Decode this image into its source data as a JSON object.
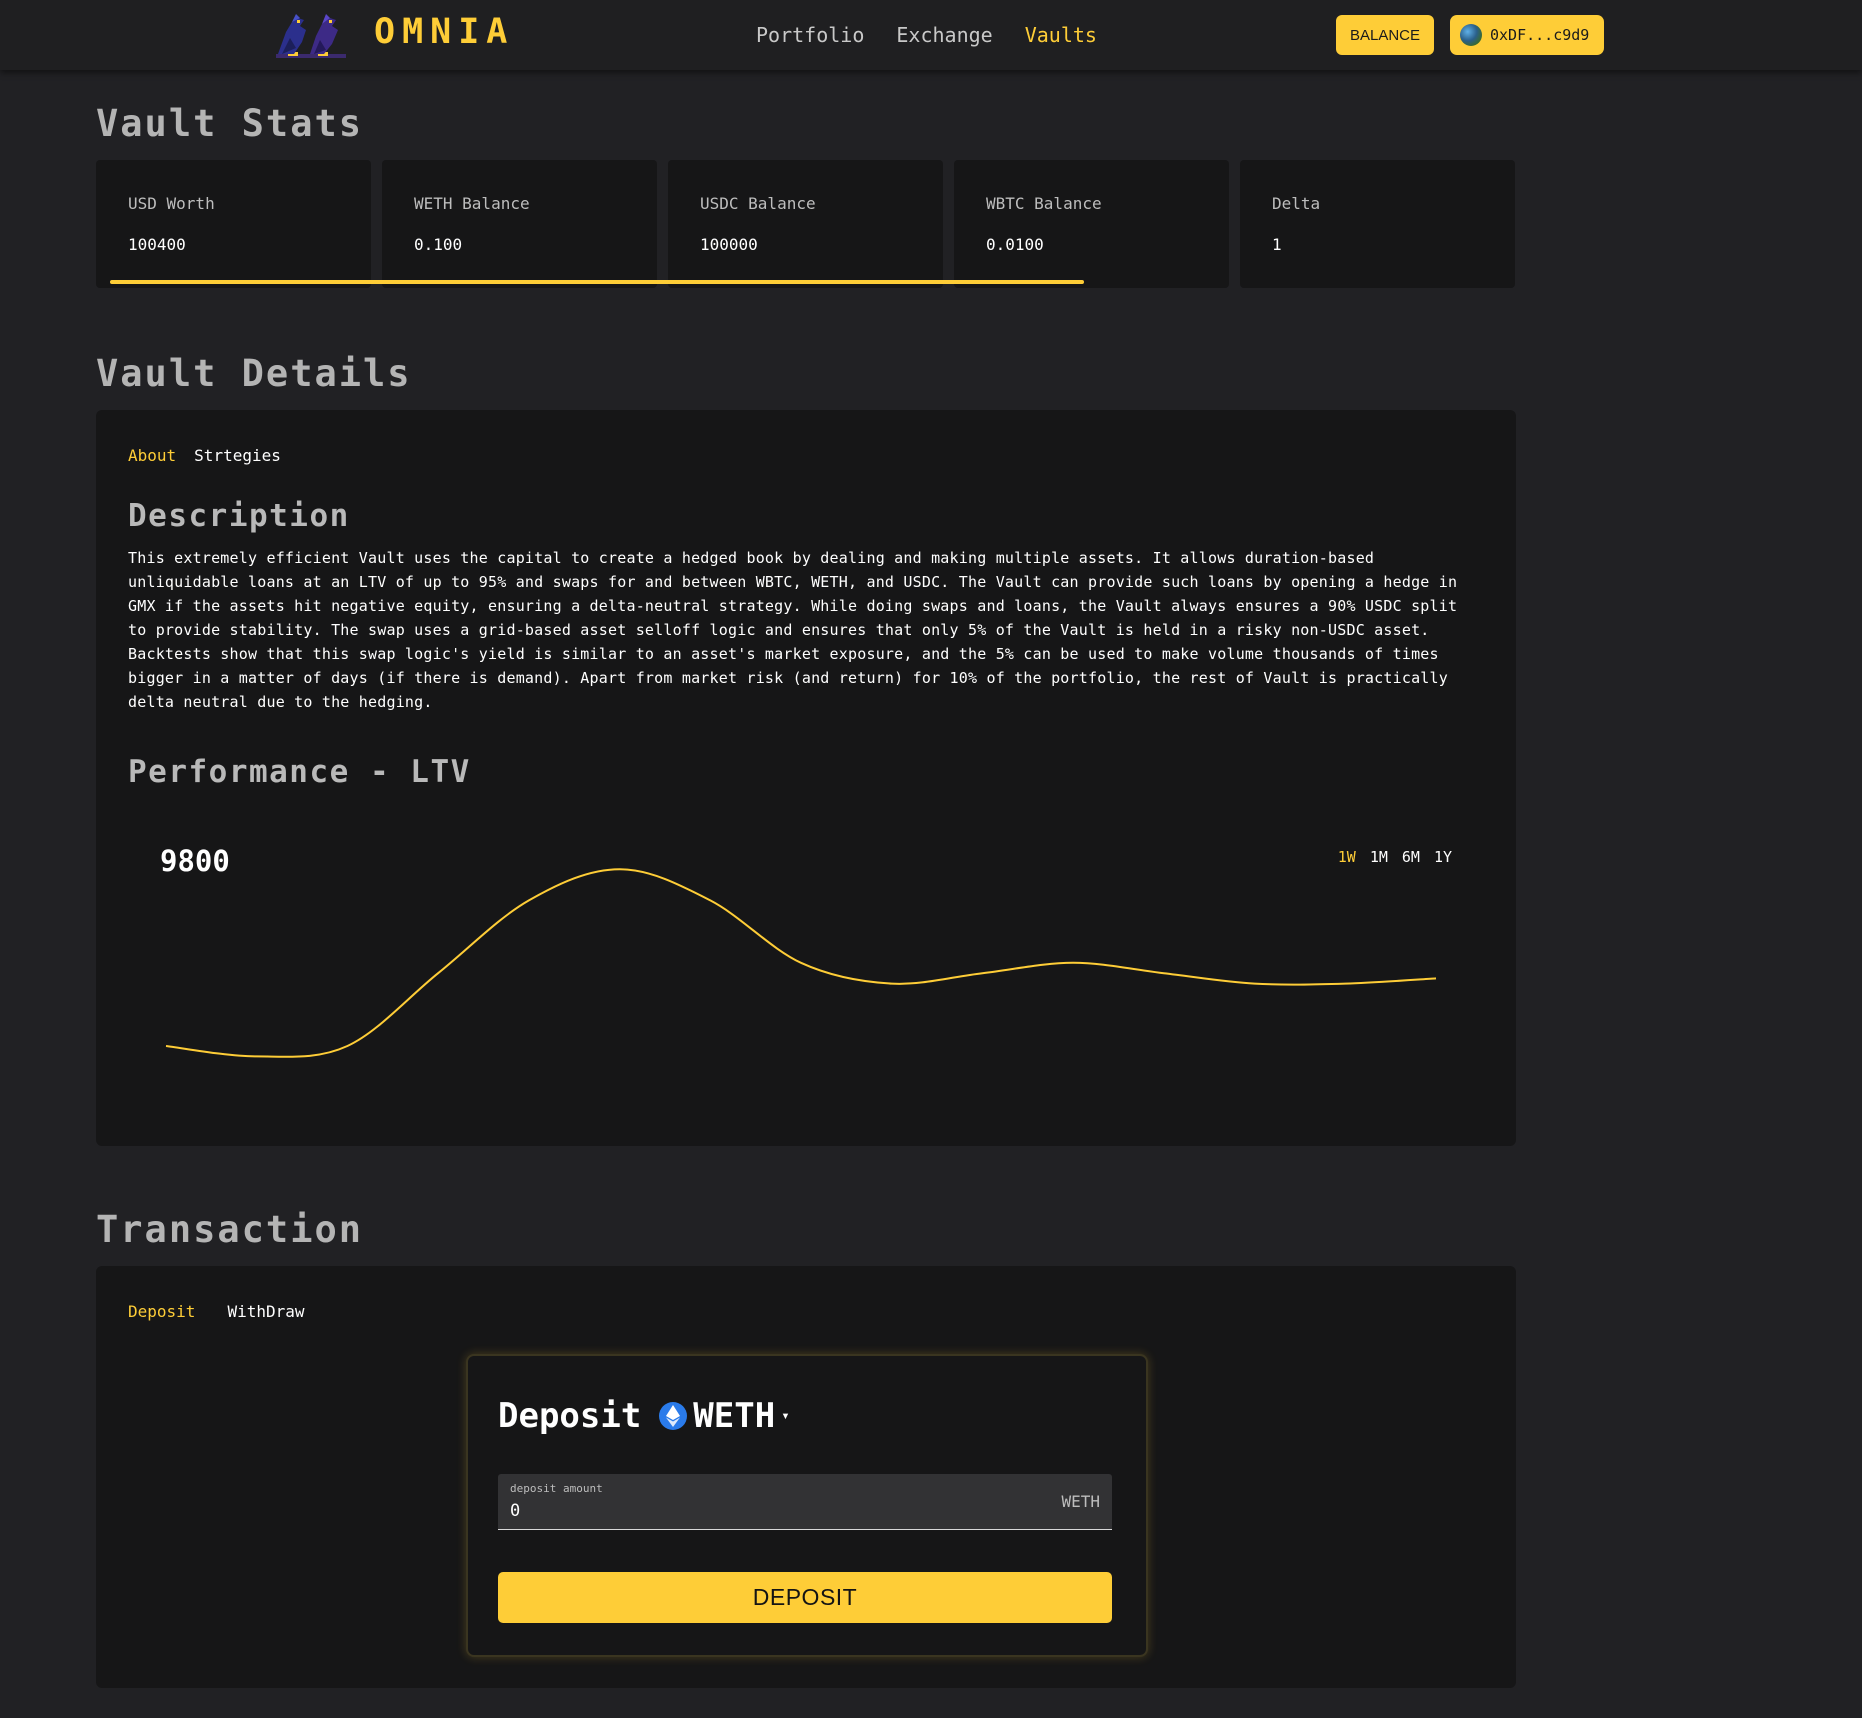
{
  "header": {
    "brand": "OMNIA",
    "nav": [
      "Portfolio",
      "Exchange",
      "Vaults"
    ],
    "active_nav": "Vaults",
    "balance_label": "BALANCE",
    "wallet_address": "0xDF...c9d9"
  },
  "vault_stats": {
    "title": "Vault Stats",
    "cards": [
      {
        "label": "USD Worth",
        "value": "100400"
      },
      {
        "label": "WETH Balance",
        "value": "0.100"
      },
      {
        "label": "USDC Balance",
        "value": "100000"
      },
      {
        "label": "WBTC Balance",
        "value": "0.0100"
      },
      {
        "label": "Delta",
        "value": "1"
      }
    ],
    "progress_fraction": 0.7
  },
  "vault_details": {
    "title": "Vault Details",
    "tabs": [
      "About",
      "Strtegies"
    ],
    "active_tab": "About",
    "description_title": "Description",
    "description_lines": [
      "This extremely efficient Vault uses the capital to create a hedged book by dealing and making multiple assets. It allows duration-based",
      "unliquidable loans at an LTV of up to 95% and swaps for and between WBTC, WETH, and USDC. The Vault can provide such loans by opening a hedge in",
      "GMX if the assets hit negative equity, ensuring a delta-neutral strategy. While doing swaps and loans, the Vault always ensures a 90% USDC split",
      "to provide stability. The swap uses a grid-based asset selloff logic and ensures that only 5% of the Vault is held in a risky non-USDC asset.",
      "Backtests show that this swap logic's yield is similar to an asset's market exposure, and the 5% can be used to make volume thousands of times",
      "bigger in a matter of days (if there is demand). Apart from market risk (and return) for 10% of the portfolio, the rest of Vault is practically",
      "delta neutral due to the hedging."
    ],
    "performance_title": "Performance - LTV",
    "current_value": "9800",
    "ranges": [
      "1W",
      "1M",
      "6M",
      "1Y"
    ],
    "active_range": "1W"
  },
  "chart_data": {
    "type": "line",
    "title": "Performance - LTV",
    "series": [
      {
        "values": [
          9700,
          9690,
          9700,
          9770,
          9840,
          9870,
          9840,
          9780,
          9760,
          9770,
          9780,
          9770,
          9760,
          9760,
          9765
        ]
      }
    ],
    "ylim": [
      9650,
      9900
    ],
    "grid": false,
    "color": "#fecd37"
  },
  "transaction": {
    "title": "Transaction",
    "tabs": [
      "Deposit",
      "WithDraw"
    ],
    "active_tab": "Deposit",
    "card_title": "Deposit",
    "token": "WETH",
    "amount_label": "deposit amount",
    "amount_value": "0",
    "amount_unit": "WETH",
    "button_label": "DEPOSIT"
  },
  "colors": {
    "accent": "#fecd37",
    "background": "#212124",
    "panel": "#161617"
  }
}
